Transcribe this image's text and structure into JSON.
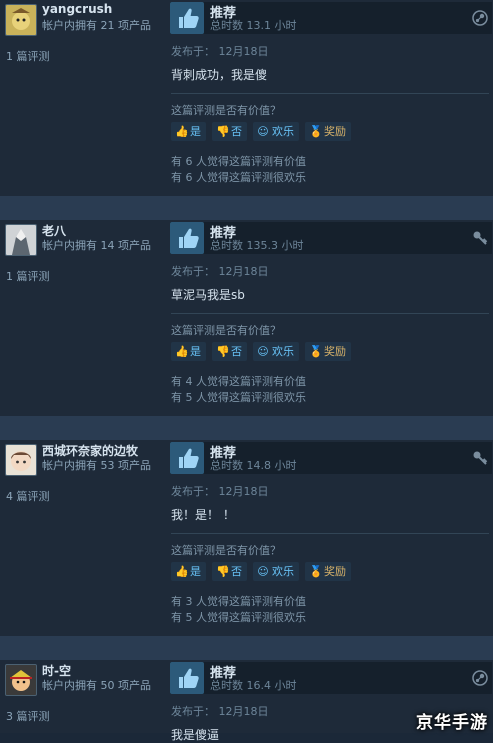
{
  "helpful_question": "这篇评测是否有价值？",
  "vote_labels": {
    "yes": "是",
    "no": "否",
    "funny": "欢乐",
    "award": "奖励"
  },
  "reviews": [
    {
      "username": "yangcrush",
      "games_owned": "帐户内拥有 21 项产品",
      "review_count": "1 篇评测",
      "recommend": "推荐",
      "hours": "总时数 13.1 小时",
      "posted": "发布于：  12月18日",
      "text": "背刺成功，我是傻",
      "helpful_votes": "有 6 人觉得这篇评测有价值",
      "funny_votes": "有 6 人觉得这篇评测很欢乐",
      "corner_icon": "steam-icon"
    },
    {
      "username": "老八",
      "games_owned": "帐户内拥有 14 项产品",
      "review_count": "1 篇评测",
      "recommend": "推荐",
      "hours": "总时数 135.3 小时",
      "posted": "发布于：  12月18日",
      "text": "草泥马我是sb",
      "helpful_votes": "有 4 人觉得这篇评测有价值",
      "funny_votes": "有 5 人觉得这篇评测很欢乐",
      "corner_icon": "key-icon"
    },
    {
      "username": "西城环奈家的边牧",
      "games_owned": "帐户内拥有 53 项产品",
      "review_count": "4 篇评测",
      "recommend": "推荐",
      "hours": "总时数 14.8 小时",
      "posted": "发布于：  12月18日",
      "text": "我！是！  ！",
      "helpful_votes": "有 3 人觉得这篇评测有价值",
      "funny_votes": "有 5 人觉得这篇评测很欢乐",
      "corner_icon": "key-icon"
    },
    {
      "username": "时-空",
      "games_owned": "帐户内拥有 50 项产品",
      "review_count": "3 篇评测",
      "recommend": "推荐",
      "hours": "总时数 16.4 小时",
      "posted": "发布于：  12月18日",
      "text": "我是傻逼",
      "corner_icon": "steam-icon"
    }
  ],
  "watermark": "京华手游"
}
